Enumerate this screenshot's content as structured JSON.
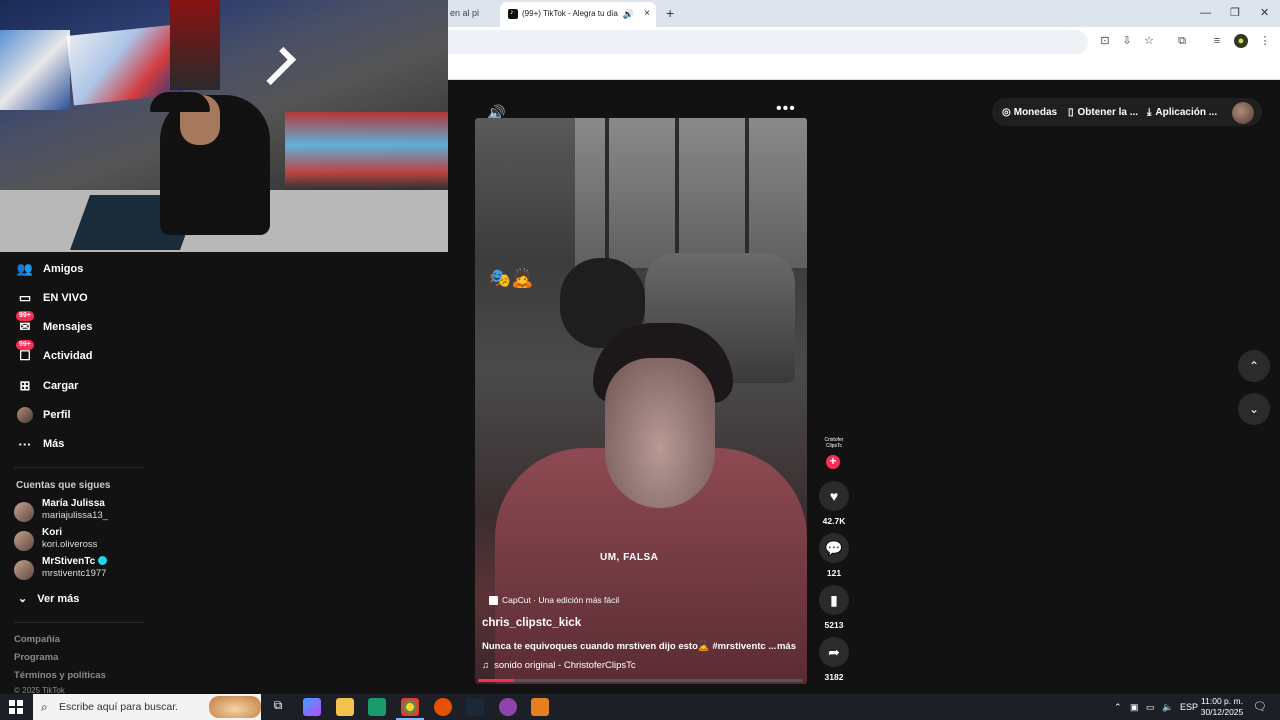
{
  "browser": {
    "prev_tab_label": "en al pi",
    "active_tab_label": "(99+) TikTok - Alegra tu día",
    "new_tab_label": "+",
    "minimize_label": "—",
    "restore_label": "❐",
    "close_label": "✕"
  },
  "sidebar": {
    "items": [
      {
        "label": "Amigos",
        "icon": "friends-icon"
      },
      {
        "label": "EN VIVO",
        "icon": "live-icon"
      },
      {
        "label": "Mensajes",
        "icon": "messages-icon",
        "badge": "99+"
      },
      {
        "label": "Actividad",
        "icon": "activity-icon",
        "badge": "99+"
      },
      {
        "label": "Cargar",
        "icon": "upload-icon"
      },
      {
        "label": "Perfil",
        "icon": "profile-avatar"
      },
      {
        "label": "Más",
        "icon": "more-icon"
      }
    ],
    "following_title": "Cuentas que sigues",
    "following": [
      {
        "name": "María Julissa",
        "handle": "mariajulissa13_"
      },
      {
        "name": "Kori",
        "handle": "kori.oliveross"
      },
      {
        "name": "MrStivenTc",
        "handle": "mrstiventc1977",
        "verified": true
      }
    ],
    "see_more": "Ver más",
    "footer": [
      "Compañía",
      "Programa",
      "Términos y políticas",
      "© 2025 TikTok"
    ]
  },
  "header": {
    "coins": "Monedas",
    "get_app": "Obtener la ...",
    "application": "Aplicación ..."
  },
  "video": {
    "overlay_caption": "UM, FALSA",
    "capcut_label": "CapCut · Una edición más fácil",
    "author": "chris_clipstc_kick",
    "description": "Nunca te equivoques cuando mrstiven dijo esto🙇 #mrstiventc ...",
    "more_label": "más",
    "sound": "sonido original - ChristoferClipsTc",
    "progress_fraction": 0.11
  },
  "actions": {
    "creator_label": "Cristofer ClipsTc",
    "likes": "42.7K",
    "comments": "121",
    "saves": "5213",
    "shares": "3182"
  },
  "taskbar": {
    "search_placeholder": "Escribe aquí para buscar.",
    "language": "ESP",
    "time": "11:00 p. m.",
    "date": "30/12/2025"
  }
}
